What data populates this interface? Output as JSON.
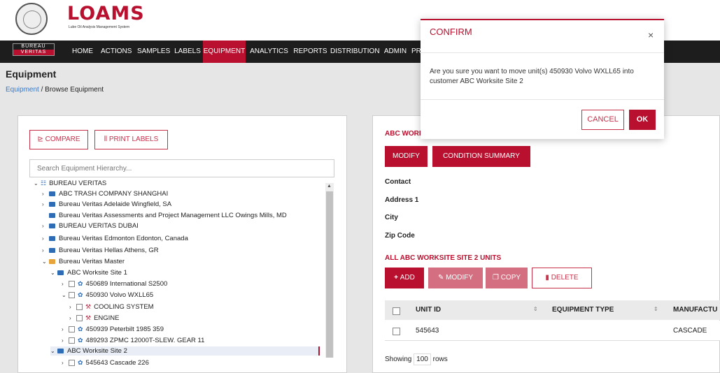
{
  "header": {
    "app_name": "LOAMS",
    "app_subtitle": "Lube Oil Analysis Management System",
    "bv_logo_line1": "BUREAU",
    "bv_logo_line2": "VERITAS"
  },
  "nav": {
    "items": [
      {
        "label": "HOME"
      },
      {
        "label": "ACTIONS"
      },
      {
        "label": "SAMPLES"
      },
      {
        "label": "LABELS"
      },
      {
        "label": "EQUIPMENT",
        "active": true
      },
      {
        "label": "ANALYTICS"
      },
      {
        "label": "REPORTS"
      },
      {
        "label": "DISTRIBUTION"
      },
      {
        "label": "ADMIN"
      },
      {
        "label": "PR"
      }
    ]
  },
  "page": {
    "title": "Equipment",
    "breadcrumb_link": "Equipment",
    "breadcrumb_sep": " / ",
    "breadcrumb_current": "Browse Equipment"
  },
  "left_panel": {
    "compare_label": "COMPARE",
    "print_labels_label": "PRINT LABELS",
    "search_placeholder": "Search Equipment Hierarchy...",
    "tree": [
      {
        "label": "BUREAU VERITAS",
        "chev": "v",
        "icon": "hier",
        "indent": 0
      },
      {
        "label": "ABC TRASH COMPANY SHANGHAI",
        "chev": ">",
        "icon": "folder",
        "indent": 1
      },
      {
        "label": "Bureau Veritas Adelaide Wingfield, SA",
        "chev": ">",
        "icon": "folder",
        "indent": 1
      },
      {
        "label": "Bureau Veritas Assessments and Project Management LLC Owings Mills, MD",
        "chev": "",
        "icon": "folder",
        "indent": 1
      },
      {
        "label": "BUREAU VERITAS DUBAI",
        "chev": ">",
        "icon": "folder",
        "indent": 1
      },
      {
        "label": "Bureau Veritas Edmonton Edonton, Canada",
        "chev": ">",
        "icon": "folder",
        "indent": 1
      },
      {
        "label": "Bureau Veritas Hellas Athens, GR",
        "chev": ">",
        "icon": "folder",
        "indent": 1
      },
      {
        "label": "Bureau Veritas Master",
        "chev": "v",
        "icon": "folder-open",
        "indent": 1
      },
      {
        "label": "ABC Worksite Site 1",
        "chev": "v",
        "icon": "folder",
        "indent": 2
      },
      {
        "label": "450689 International S2500",
        "chev": ">",
        "icon": "gear",
        "indent": 3
      },
      {
        "label": "450930 Volvo WXLL65",
        "chev": "v",
        "icon": "gear",
        "indent": 3
      },
      {
        "label": "COOLING SYSTEM",
        "chev": ">",
        "icon": "wrench",
        "indent": 4
      },
      {
        "label": "ENGINE",
        "chev": ">",
        "icon": "wrench",
        "indent": 4
      },
      {
        "label": "450939 Peterbilt 1985 359",
        "chev": ">",
        "icon": "gear",
        "indent": 3
      },
      {
        "label": "489293 ZPMC 12000T-SLEW. GEAR 11",
        "chev": ">",
        "icon": "gear",
        "indent": 3
      },
      {
        "label": "ABC Worksite Site 2",
        "chev": "v",
        "icon": "folder",
        "indent": 2,
        "selected": true
      },
      {
        "label": "545643 Cascade 226",
        "chev": ">",
        "icon": "gear",
        "indent": 3
      }
    ]
  },
  "right_panel": {
    "title_partial": "ABC WORK",
    "modify_label": "MODIFY",
    "condition_summary_label": "CONDITION SUMMARY",
    "fields": [
      "Contact",
      "Address 1",
      "City",
      "Zip Code"
    ],
    "units_heading": "ALL ABC WORKSITE SITE 2 UNITS",
    "add_label": "ADD",
    "modify2_label": "MODIFY",
    "copy_label": "COPY",
    "delete_label": "DELETE",
    "columns": [
      "UNIT ID",
      "EQUIPMENT TYPE",
      "MANUFACTU"
    ],
    "rows": [
      {
        "unit_id": "545643",
        "equipment_type": "",
        "manufacturer": "CASCADE"
      }
    ],
    "showing_prefix": "Showing",
    "page_size": "100",
    "showing_suffix": "rows"
  },
  "modal": {
    "title": "CONFIRM",
    "close_glyph": "×",
    "message": "Are you sure you want to move unit(s) 450930 Volvo WXLL65 into customer ABC Worksite Site 2",
    "cancel_label": "CANCEL",
    "ok_label": "OK"
  },
  "colors": {
    "brand_red": "#b8102e",
    "nav_bg": "#1d1d1d",
    "folder_blue": "#2e6db6",
    "folder_open": "#e6a43a"
  }
}
